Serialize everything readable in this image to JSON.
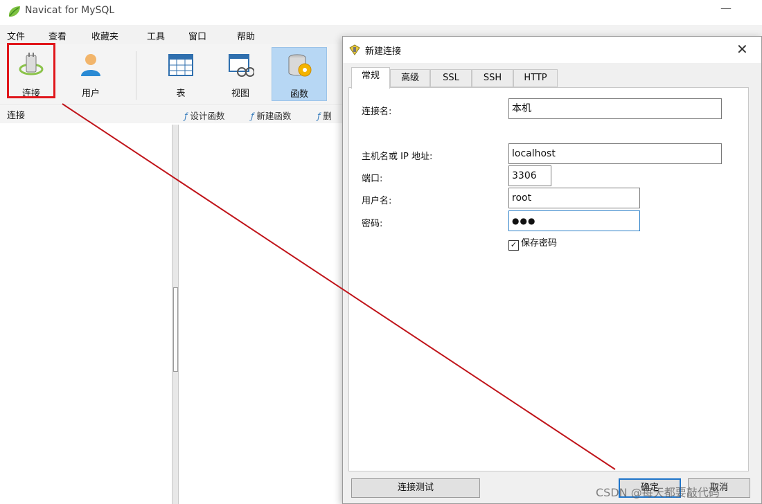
{
  "app": {
    "title": "Navicat for MySQL",
    "minimize_glyph": "—"
  },
  "menu": [
    "文件",
    "查看",
    "收藏夹",
    "工具",
    "窗口",
    "帮助"
  ],
  "toolbar": {
    "connect": "连接",
    "user": "用户",
    "table": "表",
    "view": "视图",
    "function": "函数"
  },
  "subbar": {
    "title": "连接",
    "actions": [
      "设计函数",
      "新建函数",
      "删"
    ]
  },
  "dialog": {
    "title": "新建连接",
    "close_glyph": "✕",
    "tabs": [
      "常规",
      "高级",
      "SSL",
      "SSH",
      "HTTP"
    ],
    "active_tab": "常规",
    "fields": {
      "connection_name": {
        "label": "连接名:",
        "value": "本机"
      },
      "host": {
        "label": "主机名或 IP 地址:",
        "value": "localhost"
      },
      "port": {
        "label": "端口:",
        "value": "3306"
      },
      "username": {
        "label": "用户名:",
        "value": "root"
      },
      "password": {
        "label": "密码:",
        "value": "●●●"
      }
    },
    "save_password": {
      "label": "保存密码",
      "checked": true
    },
    "buttons": {
      "test": "连接测试",
      "ok": "确定",
      "cancel": "取消"
    }
  },
  "watermark": "CSDN @每天都要敲代码",
  "colors": {
    "highlight": "#e0161b",
    "annotation_line": "#c0141a",
    "selected_tool": "#b7d7f4",
    "focus_border": "#2a7fc8"
  },
  "icons": [
    "navicat-logo-icon",
    "connect-plug-icon",
    "user-icon",
    "table-icon",
    "view-icon",
    "function-icon",
    "dialog-connection-icon",
    "close-icon",
    "checkbox-checked-icon"
  ]
}
